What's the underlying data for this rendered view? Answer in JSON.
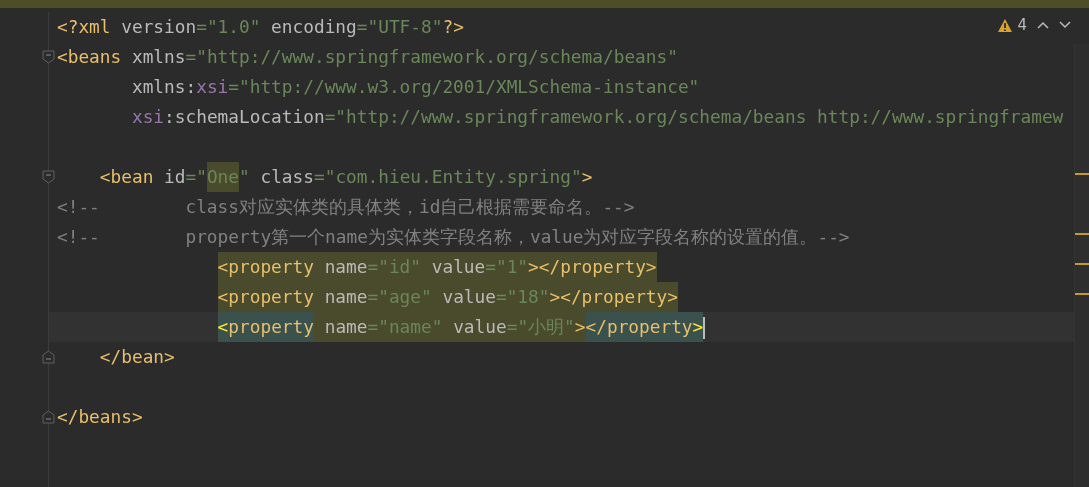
{
  "inspections": {
    "count": "4"
  },
  "lines": [
    {
      "collapsible": false,
      "block_end": false,
      "current": false,
      "marked": false,
      "tokens": [
        {
          "text": "<?xml ",
          "kind": "tag",
          "highlighted": false,
          "matched": false
        },
        {
          "text": "version",
          "kind": "attr",
          "highlighted": false,
          "matched": false
        },
        {
          "text": "=\"1.0\"",
          "kind": "str",
          "highlighted": false,
          "matched": false
        },
        {
          "text": " encoding",
          "kind": "attr",
          "highlighted": false,
          "matched": false
        },
        {
          "text": "=\"UTF-8\"",
          "kind": "str",
          "highlighted": false,
          "matched": false
        },
        {
          "text": "?>",
          "kind": "tag",
          "highlighted": false,
          "matched": false
        }
      ]
    },
    {
      "collapsible": true,
      "block_end": false,
      "current": false,
      "marked": false,
      "tokens": [
        {
          "text": "<beans",
          "kind": "tag",
          "highlighted": false,
          "matched": false
        },
        {
          "text": " xmlns",
          "kind": "attr",
          "highlighted": false,
          "matched": false
        },
        {
          "text": "=\"http://www.springframework.org/schema/beans\"",
          "kind": "str",
          "highlighted": false,
          "matched": false
        }
      ]
    },
    {
      "collapsible": false,
      "block_end": false,
      "current": false,
      "marked": false,
      "tokens": [
        {
          "text": "       xmlns:",
          "kind": "attr",
          "highlighted": false,
          "matched": false
        },
        {
          "text": "xsi",
          "kind": "ns",
          "highlighted": false,
          "matched": false
        },
        {
          "text": "=\"http://www.w3.org/2001/XMLSchema-instance\"",
          "kind": "str",
          "highlighted": false,
          "matched": false
        }
      ]
    },
    {
      "collapsible": false,
      "block_end": false,
      "current": false,
      "marked": false,
      "tokens": [
        {
          "text": "       xsi",
          "kind": "ns",
          "highlighted": false,
          "matched": false
        },
        {
          "text": ":schemaLocation",
          "kind": "attr",
          "highlighted": false,
          "matched": false
        },
        {
          "text": "=\"http://www.springframework.org/schema/beans http://www.springframew",
          "kind": "str",
          "highlighted": false,
          "matched": false
        }
      ]
    },
    {
      "collapsible": false,
      "block_end": false,
      "marked": false
    },
    {
      "collapsible": true,
      "block_end": false,
      "current": false,
      "marked": true,
      "tokens": [
        {
          "text": "    <bean",
          "kind": "tag",
          "highlighted": false,
          "matched": false
        },
        {
          "text": " id",
          "kind": "attr",
          "highlighted": false,
          "matched": false
        },
        {
          "text": "=\"",
          "kind": "str",
          "highlighted": false,
          "matched": false
        },
        {
          "text": "One",
          "kind": "str",
          "highlighted": true,
          "matched": false
        },
        {
          "text": "\"",
          "kind": "str",
          "highlighted": false,
          "matched": false
        },
        {
          "text": " class",
          "kind": "attr",
          "highlighted": false,
          "matched": false
        },
        {
          "text": "=\"com.hieu.Entity.spring\"",
          "kind": "str",
          "highlighted": false,
          "matched": false
        },
        {
          "text": ">",
          "kind": "tag",
          "highlighted": false,
          "matched": false
        }
      ]
    },
    {
      "collapsible": false,
      "block_end": false,
      "current": false,
      "marked": false,
      "tokens": [
        {
          "text": "<!--        class对应实体类的具体类，id自己根据需要命名。-->",
          "kind": "comment",
          "highlighted": false,
          "matched": false
        }
      ]
    },
    {
      "collapsible": false,
      "block_end": false,
      "current": false,
      "marked": true,
      "tokens": [
        {
          "text": "<!--        property第一个name为实体类字段名称，value为对应字段名称的设置的值。-->",
          "kind": "comment",
          "highlighted": false,
          "matched": false
        }
      ]
    },
    {
      "collapsible": false,
      "block_end": false,
      "current": false,
      "marked": true,
      "tokens": [
        {
          "text": "               <property",
          "kind": "tag",
          "highlighted": true,
          "matched": false
        },
        {
          "text": " name",
          "kind": "attr",
          "highlighted": true,
          "matched": false
        },
        {
          "text": "=\"id\"",
          "kind": "str",
          "highlighted": true,
          "matched": false
        },
        {
          "text": " value",
          "kind": "attr",
          "highlighted": true,
          "matched": false
        },
        {
          "text": "=\"1\"",
          "kind": "str",
          "highlighted": true,
          "matched": false
        },
        {
          "text": "></property>",
          "kind": "tag",
          "highlighted": true,
          "matched": false
        }
      ]
    },
    {
      "collapsible": false,
      "block_end": false,
      "current": false,
      "marked": true,
      "tokens": [
        {
          "text": "               <property",
          "kind": "tag",
          "highlighted": true,
          "matched": false
        },
        {
          "text": " name",
          "kind": "attr",
          "highlighted": true,
          "matched": false
        },
        {
          "text": "=\"age\"",
          "kind": "str",
          "highlighted": true,
          "matched": false
        },
        {
          "text": " value",
          "kind": "attr",
          "highlighted": true,
          "matched": false
        },
        {
          "text": "=\"18\"",
          "kind": "str",
          "highlighted": true,
          "matched": false
        },
        {
          "text": "></property>",
          "kind": "tag",
          "highlighted": true,
          "matched": false
        }
      ]
    },
    {
      "collapsible": false,
      "block_end": false,
      "current": true,
      "marked": false,
      "tokens": [
        {
          "text": "               <",
          "kind": "brace",
          "highlighted": false,
          "matched": true
        },
        {
          "text": "property",
          "kind": "tag",
          "highlighted": false,
          "matched": true
        },
        {
          "text": " name",
          "kind": "attr",
          "highlighted": true,
          "matched": false
        },
        {
          "text": "=\"name\"",
          "kind": "str",
          "highlighted": true,
          "matched": false
        },
        {
          "text": " value",
          "kind": "attr",
          "highlighted": true,
          "matched": false
        },
        {
          "text": "=\"小明\"",
          "kind": "str",
          "highlighted": true,
          "matched": false
        },
        {
          "text": ">",
          "kind": "tag",
          "highlighted": true,
          "matched": false
        },
        {
          "text": "</property",
          "kind": "tag",
          "highlighted": false,
          "matched": true
        },
        {
          "text": ">",
          "kind": "brace",
          "highlighted": false,
          "matched": true
        }
      ]
    },
    {
      "collapsible": false,
      "block_end": true,
      "current": false,
      "marked": false,
      "tokens": [
        {
          "text": "    </bean>",
          "kind": "tag",
          "highlighted": false,
          "matched": false
        }
      ]
    },
    {
      "collapsible": false,
      "block_end": false,
      "marked": false
    },
    {
      "collapsible": false,
      "block_end": true,
      "current": false,
      "marked": false,
      "tokens": [
        {
          "text": "</beans>",
          "kind": "tag",
          "highlighted": false,
          "matched": false
        }
      ]
    },
    {
      "collapsible": false,
      "block_end": false,
      "marked": false
    },
    {
      "collapsible": false,
      "block_end": false,
      "marked": false
    }
  ]
}
